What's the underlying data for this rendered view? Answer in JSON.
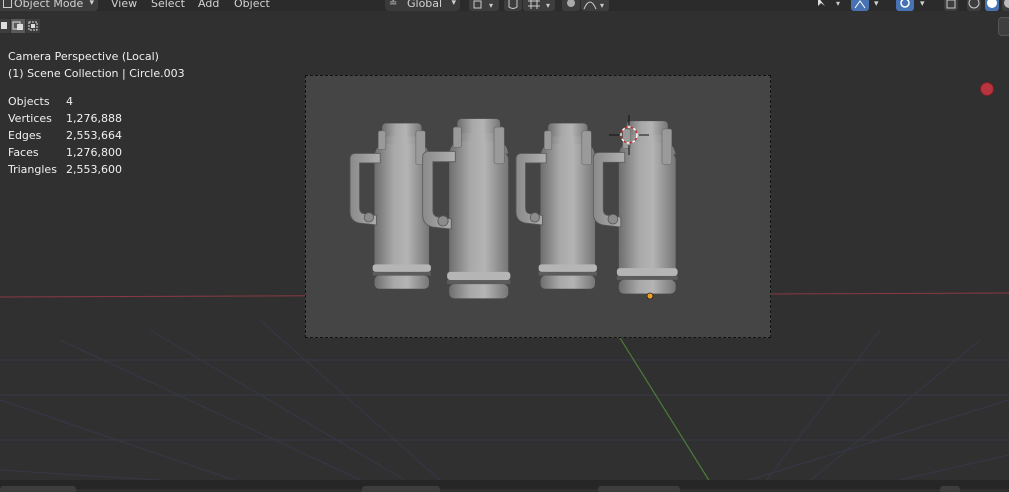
{
  "header": {
    "mode": "Object Mode",
    "menu": [
      "View",
      "Select",
      "Add",
      "Object"
    ],
    "orientation": "Global"
  },
  "overlay": {
    "camera": "Camera Perspective (Local)",
    "collection": "(1) Scene Collection | Circle.003",
    "stats": [
      {
        "label": "Objects",
        "value": "4"
      },
      {
        "label": "Vertices",
        "value": "1,276,888"
      },
      {
        "label": "Edges",
        "value": "2,553,664"
      },
      {
        "label": "Faces",
        "value": "1,276,800"
      },
      {
        "label": "Triangles",
        "value": "2,553,600"
      }
    ]
  },
  "icons": {
    "mode": "object-mode-icon",
    "orientation": "transform-orientation-icon",
    "pivot": "pivot-point-icon",
    "snap": "snap-magnet-icon",
    "snap_grid": "snap-grid-icon",
    "proportional": "proportional-edit-icon",
    "falloff": "falloff-curve-icon",
    "cursor": "3d-cursor-icon",
    "record": "record-icon"
  },
  "colors": {
    "viewport_bg": "#303030",
    "camera_frame_bg": "#454545",
    "x_axis": "#8a3a44",
    "y_axis": "#4d7a3a",
    "active_button": "#4772b3",
    "record": "#b8343e",
    "origin_dot": "#f0a020"
  }
}
